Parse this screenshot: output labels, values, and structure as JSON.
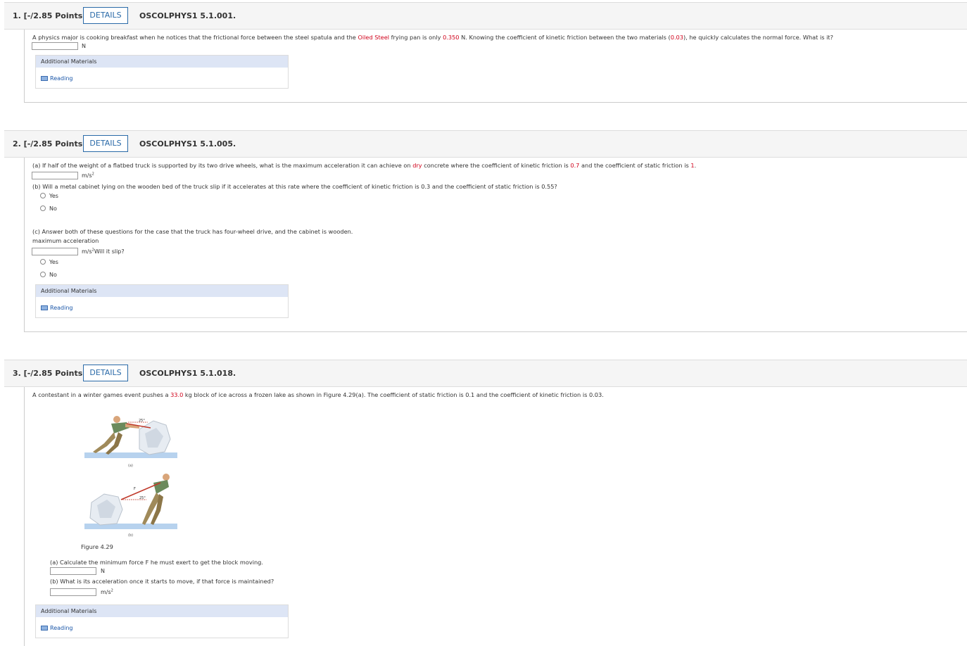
{
  "q1": {
    "number": "1. [-/2.85 Points]",
    "details": "DETAILS",
    "code": "OSCOLPHYS1 5.1.001.",
    "text_a": "A physics major is cooking breakfast when he notices that the frictional force between the steel spatula and the ",
    "red1": "Oiled Steel",
    "text_b": " frying pan is only ",
    "red2": "0.350",
    "text_c": " N. Knowing the coefficient of kinetic friction between the two materials (",
    "red3": "0.03",
    "text_d": "), he quickly calculates the normal force. What is it?",
    "unit": "N",
    "am_title": "Additional Materials",
    "reading": "Reading"
  },
  "q2": {
    "number": "2. [-/2.85 Points]",
    "details": "DETAILS",
    "code": "OSCOLPHYS1 5.1.005.",
    "a_text1": "(a) If half of the weight of a flatbed truck is supported by its two drive wheels, what is the maximum acceleration it can achieve on ",
    "a_red1": "dry",
    "a_text2": " concrete where the coefficient of kinetic friction is ",
    "a_red2": "0.7",
    "a_text3": " and the coefficient of static friction is ",
    "a_red3": "1",
    "a_text4": ".",
    "a_unit": "m/s",
    "b_text": "(b) Will a metal cabinet lying on the wooden bed of the truck slip if it accelerates at this rate where the coefficient of kinetic friction is 0.3 and the coefficient of static friction is 0.55?",
    "yes": "Yes",
    "no": "No",
    "c_text": "(c) Answer both of these questions for the case that the truck has four-wheel drive, and the cabinet is wooden.",
    "c_label": "maximum acceleration",
    "c_unit": "m/s",
    "c_slip": "Will it slip?",
    "am_title": "Additional Materials",
    "reading": "Reading"
  },
  "q3": {
    "number": "3. [-/2.85 Points]",
    "details": "DETAILS",
    "code": "OSCOLPHYS1 5.1.018.",
    "text_a": "A contestant in a winter games event pushes a ",
    "red1": "33.0",
    "text_b": " kg block of ice across a frozen lake as shown in Figure 4.29(a). The coefficient of static friction is 0.1 and the coefficient of kinetic friction is 0.03.",
    "fig_a_label": "(a)",
    "fig_b_label": "(b)",
    "fig_angle": "25°",
    "fig_force": "F",
    "figure_caption": "Figure 4.29",
    "a_text": "(a) Calculate the minimum force F he must exert to get the block moving.",
    "a_unit": "N",
    "b_text": "(b) What is its acceleration once it starts to move, if that force is maintained?",
    "b_unit": "m/s",
    "am_title": "Additional Materials",
    "reading": "Reading"
  }
}
